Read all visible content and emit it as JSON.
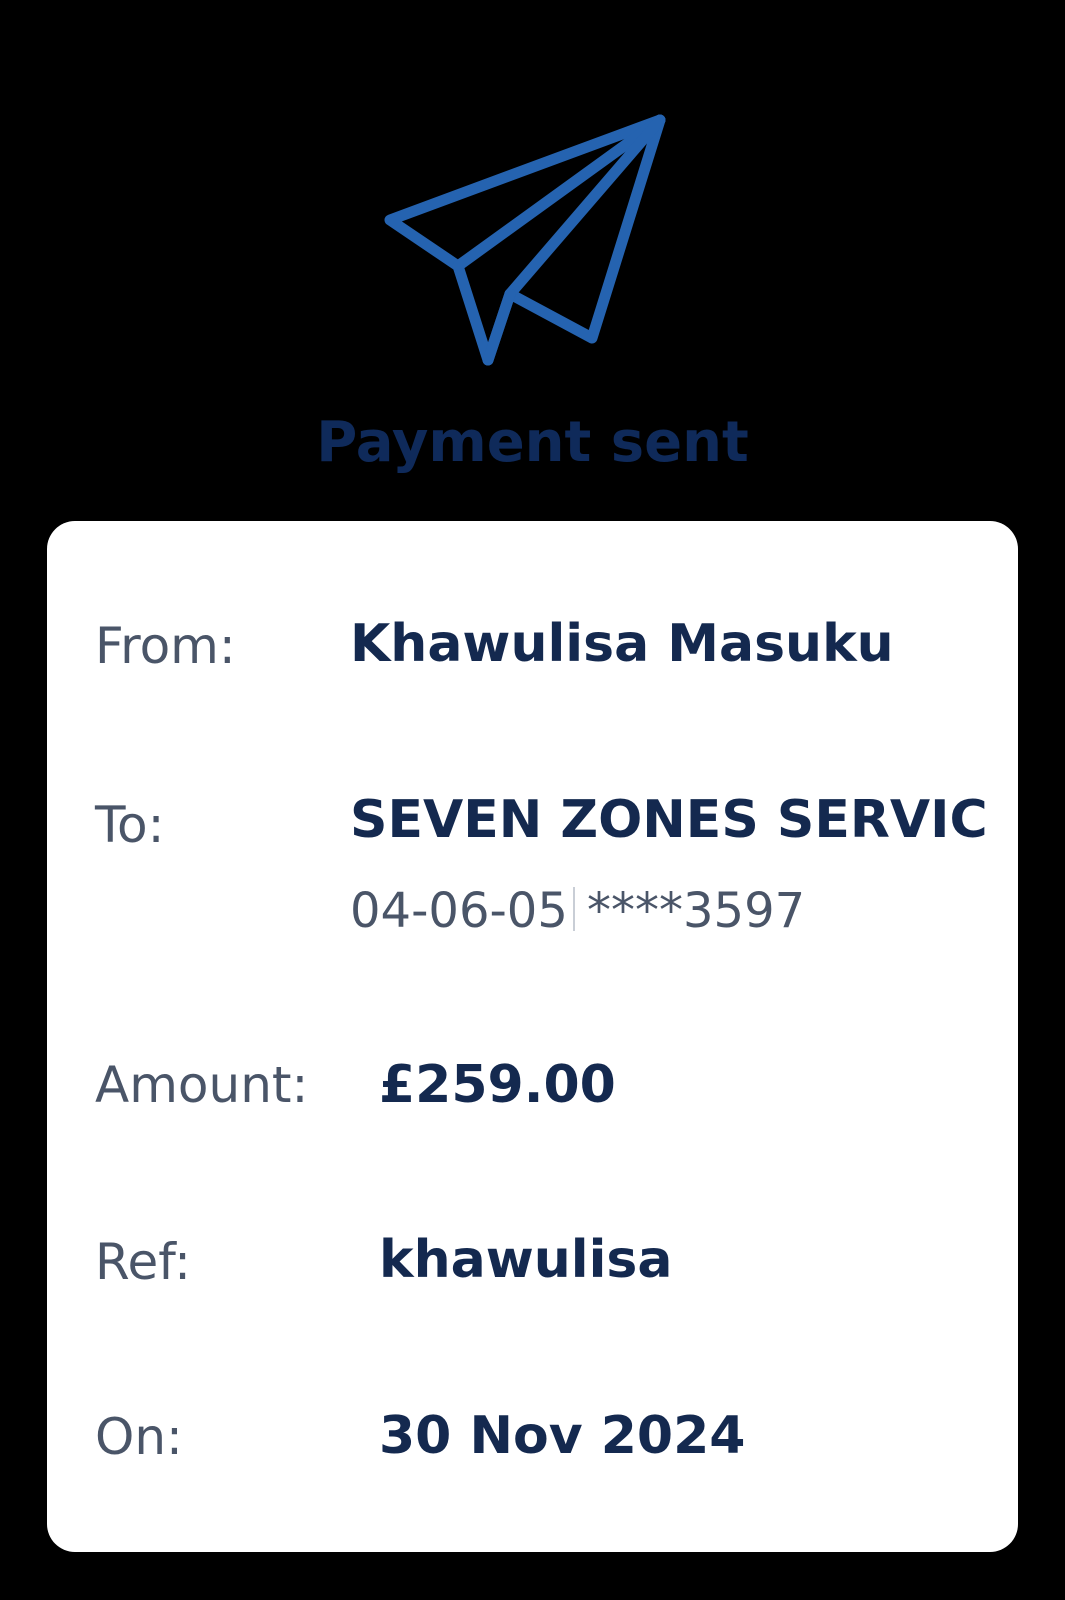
{
  "status": {
    "icon": "paper-plane-icon",
    "title": "Payment sent",
    "accent_color": "#2563b0",
    "title_color": "#0f2a5a"
  },
  "details": {
    "from": {
      "label": "From:",
      "value": "Khawulisa Masuku"
    },
    "to": {
      "label": "To:",
      "value": "SEVEN ZONES SERVIC",
      "sort_code": "04-06-05",
      "account": "****3597"
    },
    "amount": {
      "label": "Amount:",
      "value": "£259.00"
    },
    "ref": {
      "label": "Ref:",
      "value": "khawulisa"
    },
    "on": {
      "label": "On:",
      "value": "30 Nov 2024"
    }
  }
}
